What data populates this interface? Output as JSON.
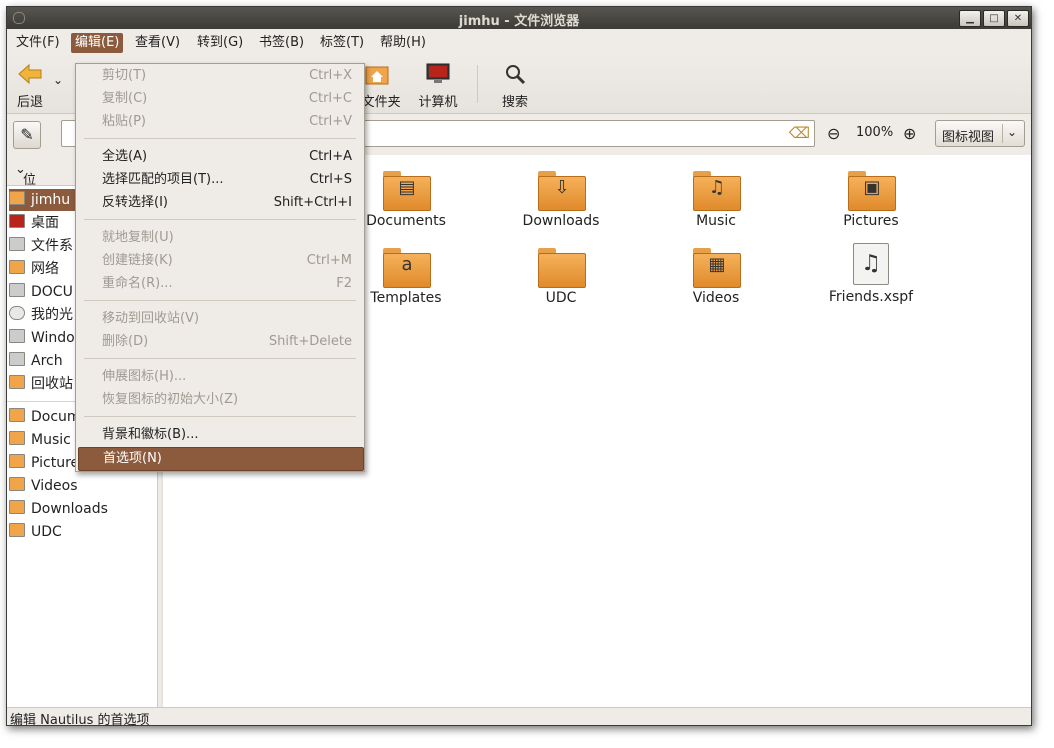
{
  "window": {
    "title": "jimhu - 文件浏览器",
    "minimize": "▁",
    "maximize": "□",
    "close": "✕"
  },
  "menubar": [
    {
      "label": "文件(F)"
    },
    {
      "label": "编辑(E)"
    },
    {
      "label": "查看(V)"
    },
    {
      "label": "转到(G)"
    },
    {
      "label": "书签(B)"
    },
    {
      "label": "标签(T)"
    },
    {
      "label": "帮助(H)"
    }
  ],
  "toolbar": {
    "back": "后退",
    "back_icon": "left-arrow-icon",
    "home_folder_partial": "E文件夹",
    "computer": "计算机",
    "search": "搜索"
  },
  "location": {
    "edit_icon": "pencil-icon",
    "prefix_partial": "位",
    "zoom_level": "100%",
    "view_mode": "图标视图"
  },
  "sidebar": {
    "header": "位置",
    "items": [
      {
        "label": "jimhu",
        "icon": "home-folder-icon"
      },
      {
        "label": "桌面",
        "icon": "desktop-icon"
      },
      {
        "label": "文件系",
        "icon": "drive-icon"
      },
      {
        "label": "网络",
        "icon": "network-icon"
      },
      {
        "label": "DOCU",
        "icon": "drive-icon"
      },
      {
        "label": "我的光",
        "icon": "cdrom-icon"
      },
      {
        "label": "Windo",
        "icon": "drive-icon"
      },
      {
        "label": "Arch",
        "icon": "drive-icon"
      },
      {
        "label": "回收站",
        "icon": "trash-icon"
      }
    ],
    "bookmarks": [
      {
        "label": "Docum",
        "icon": "documents-folder-icon"
      },
      {
        "label": "Music",
        "icon": "music-folder-icon"
      },
      {
        "label": "Picture",
        "icon": "pictures-folder-icon"
      },
      {
        "label": "Videos",
        "icon": "videos-folder-icon"
      },
      {
        "label": "Downloads",
        "icon": "downloads-folder-icon"
      },
      {
        "label": "UDC",
        "icon": "folder-icon"
      }
    ]
  },
  "files": [
    {
      "label": "Documents",
      "glyph": "▤"
    },
    {
      "label": "Downloads",
      "glyph": "⇩"
    },
    {
      "label": "Music",
      "glyph": "♫"
    },
    {
      "label": "Pictures",
      "glyph": "▣"
    },
    {
      "label": "Templates",
      "glyph": "a"
    },
    {
      "label": "UDC",
      "glyph": ""
    },
    {
      "label": "Videos",
      "glyph": "▦"
    },
    {
      "label": "Friends.xspf",
      "glyph": "♫"
    }
  ],
  "edit_menu": {
    "cut": {
      "label": "剪切(T)",
      "accel": "Ctrl+X"
    },
    "copy": {
      "label": "复制(C)",
      "accel": "Ctrl+C"
    },
    "paste": {
      "label": "粘贴(P)",
      "accel": "Ctrl+V"
    },
    "select_all": {
      "label": "全选(A)",
      "accel": "Ctrl+A"
    },
    "select_pattern": {
      "label": "选择匹配的项目(T)...",
      "accel": "Ctrl+S"
    },
    "invert": {
      "label": "反转选择(I)",
      "accel": "Shift+Ctrl+I"
    },
    "duplicate": {
      "label": "就地复制(U)",
      "accel": ""
    },
    "make_link": {
      "label": "创建链接(K)",
      "accel": "Ctrl+M"
    },
    "rename": {
      "label": "重命名(R)...",
      "accel": "F2"
    },
    "trash": {
      "label": "移动到回收站(V)",
      "accel": ""
    },
    "delete": {
      "label": "删除(D)",
      "accel": "Shift+Delete"
    },
    "stretch": {
      "label": "伸展图标(H)...",
      "accel": ""
    },
    "restore": {
      "label": "恢复图标的初始大小(Z)",
      "accel": ""
    },
    "backgrounds": {
      "label": "背景和徽标(B)...",
      "accel": ""
    },
    "preferences": {
      "label": "首选项(N)",
      "accel": ""
    }
  },
  "statusbar": {
    "text": "编辑 Nautilus 的首选项"
  }
}
